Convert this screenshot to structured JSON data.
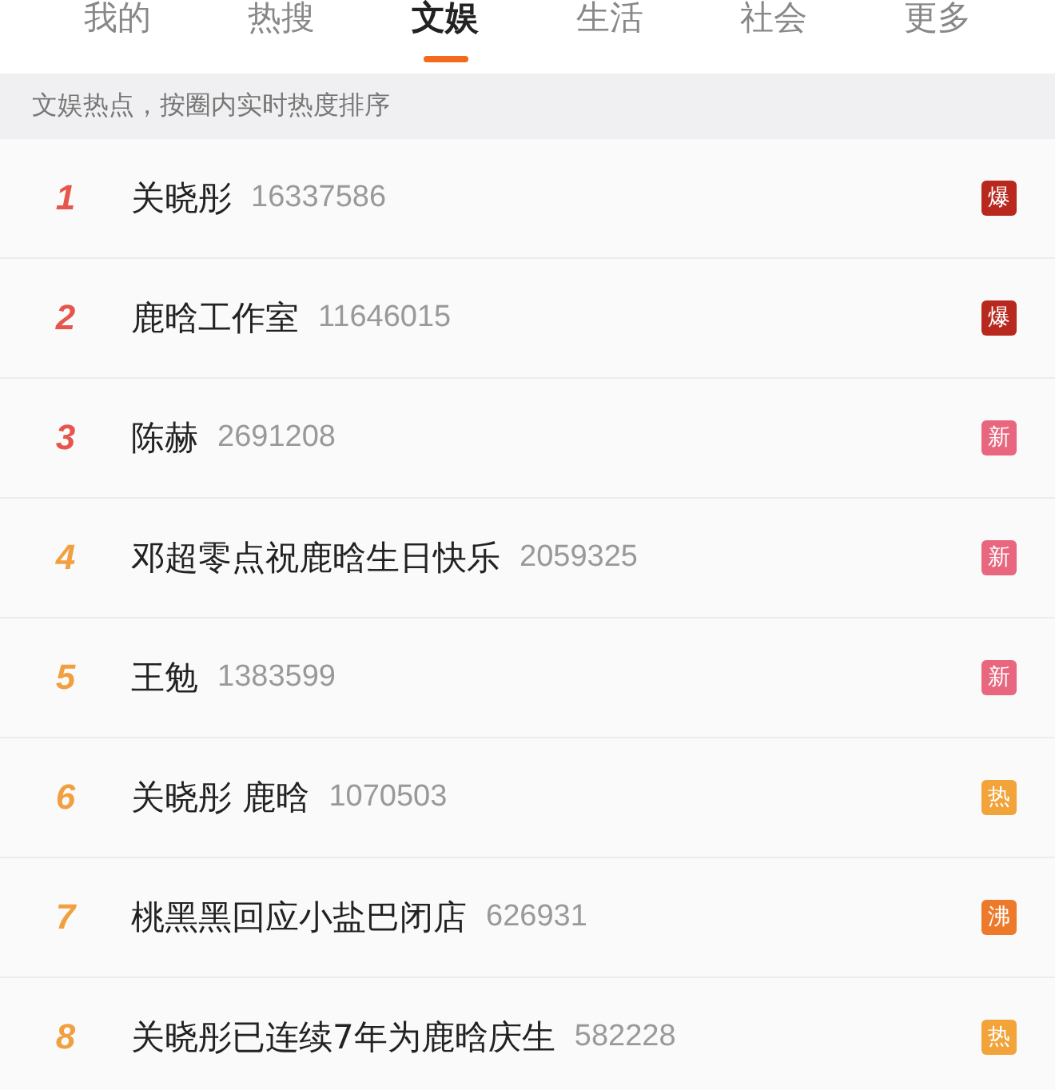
{
  "tabs": [
    {
      "label": "我的",
      "selected": false
    },
    {
      "label": "热搜",
      "selected": false
    },
    {
      "label": "文娱",
      "selected": true
    },
    {
      "label": "生活",
      "selected": false
    },
    {
      "label": "社会",
      "selected": false
    },
    {
      "label": "更多",
      "selected": false
    }
  ],
  "notice": "文娱热点，按圈内实时热度排序",
  "items": [
    {
      "rank": {
        "text": "1",
        "color": "#e6564e"
      },
      "title": "关晓彤",
      "count": "16337586",
      "badge": {
        "text": "爆",
        "color": "#b8281f"
      }
    },
    {
      "rank": {
        "text": "2",
        "color": "#e6564e"
      },
      "title": "鹿晗工作室",
      "count": "11646015",
      "badge": {
        "text": "爆",
        "color": "#b8281f"
      }
    },
    {
      "rank": {
        "text": "3",
        "color": "#e6564e"
      },
      "title": "陈赫",
      "count": "2691208",
      "badge": {
        "text": "新",
        "color": "#e8677f"
      }
    },
    {
      "rank": {
        "text": "4",
        "color": "#f0a040"
      },
      "title": "邓超零点祝鹿晗生日快乐",
      "count": "2059325",
      "badge": {
        "text": "新",
        "color": "#e8677f"
      }
    },
    {
      "rank": {
        "text": "5",
        "color": "#f0a040"
      },
      "title": "王勉",
      "count": "1383599",
      "badge": {
        "text": "新",
        "color": "#e8677f"
      }
    },
    {
      "rank": {
        "text": "6",
        "color": "#f0a040"
      },
      "title": "关晓彤 鹿晗",
      "count": "1070503",
      "badge": {
        "text": "热",
        "color": "#f2a33a"
      }
    },
    {
      "rank": {
        "text": "7",
        "color": "#f0a040"
      },
      "title": "桃黑黑回应小盐巴闭店",
      "count": "626931",
      "badge": {
        "text": "沸",
        "color": "#ec7a2a"
      }
    },
    {
      "rank": {
        "text": "8",
        "color": "#f0a040"
      },
      "title": "关晓彤已连续7年为鹿晗庆生",
      "count": "582228",
      "badge": {
        "text": "热",
        "color": "#f2a33a"
      }
    }
  ]
}
